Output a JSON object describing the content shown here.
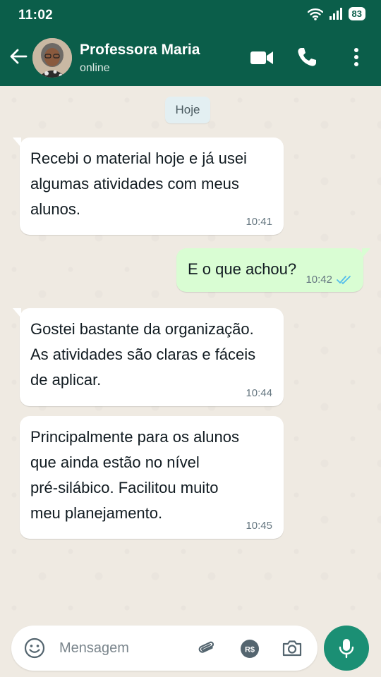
{
  "status": {
    "time": "11:02",
    "battery": "83"
  },
  "header": {
    "contact_name": "Professora Maria",
    "contact_status": "online"
  },
  "chat": {
    "date_chip": "Hoje",
    "messages": [
      {
        "direction": "in",
        "lines": [
          "Recebi o material hoje e já usei",
          "algumas atividades com meus",
          "alunos."
        ],
        "time": "10:41"
      },
      {
        "direction": "out",
        "lines": [
          "E o que achou?"
        ],
        "time": "10:42",
        "read": true
      },
      {
        "direction": "in",
        "lines": [
          "Gostei bastante da organização.",
          "As atividades são claras e fáceis",
          "de aplicar."
        ],
        "time": "10:44"
      },
      {
        "direction": "in",
        "lines": [
          "Principalmente para os alunos",
          "que ainda estão no nível",
          "pré-silábico. Facilitou muito",
          "meu planejamento."
        ],
        "time": "10:45"
      }
    ]
  },
  "composer": {
    "placeholder": "Mensagem",
    "value": ""
  },
  "colors": {
    "header": "#0b5e4a",
    "incoming": "#ffffff",
    "outgoing": "#d9fdd3",
    "accent": "#1b8f74",
    "read_ticks": "#53bdeb"
  }
}
